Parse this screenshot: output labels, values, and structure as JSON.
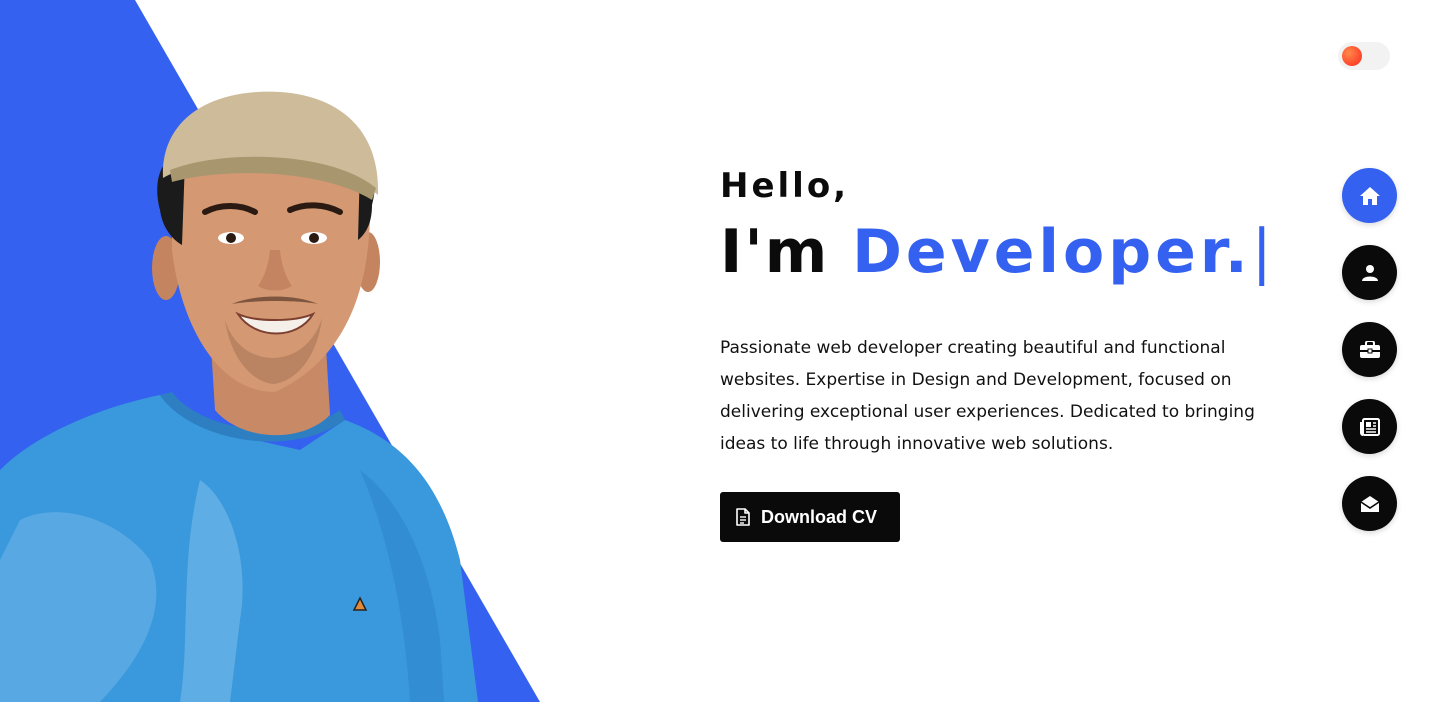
{
  "hero": {
    "greeting": "Hello,",
    "intro": "I'm ",
    "role": "Developer.",
    "cursor": "|",
    "bio": "Passionate web developer creating beautiful and functional websites. Expertise in Design and Development, focused on delivering exceptional user experiences. Dedicated to bringing ideas to life through innovative web solutions.",
    "cv_button_label": "Download CV",
    "cv_button_icon": "file-text-icon"
  },
  "theme_toggle": {
    "state": "light",
    "knob_color": "#ff4d2e"
  },
  "side_nav": {
    "items": [
      {
        "name": "home",
        "icon": "home-icon",
        "active": true
      },
      {
        "name": "about",
        "icon": "user-icon",
        "active": false
      },
      {
        "name": "portfolio",
        "icon": "briefcase-icon",
        "active": false
      },
      {
        "name": "blog",
        "icon": "newspaper-icon",
        "active": false
      },
      {
        "name": "contact",
        "icon": "envelope-open-icon",
        "active": false
      }
    ]
  },
  "colors": {
    "accent": "#3461f0",
    "dark": "#0a0a0a",
    "background": "#ffffff"
  }
}
